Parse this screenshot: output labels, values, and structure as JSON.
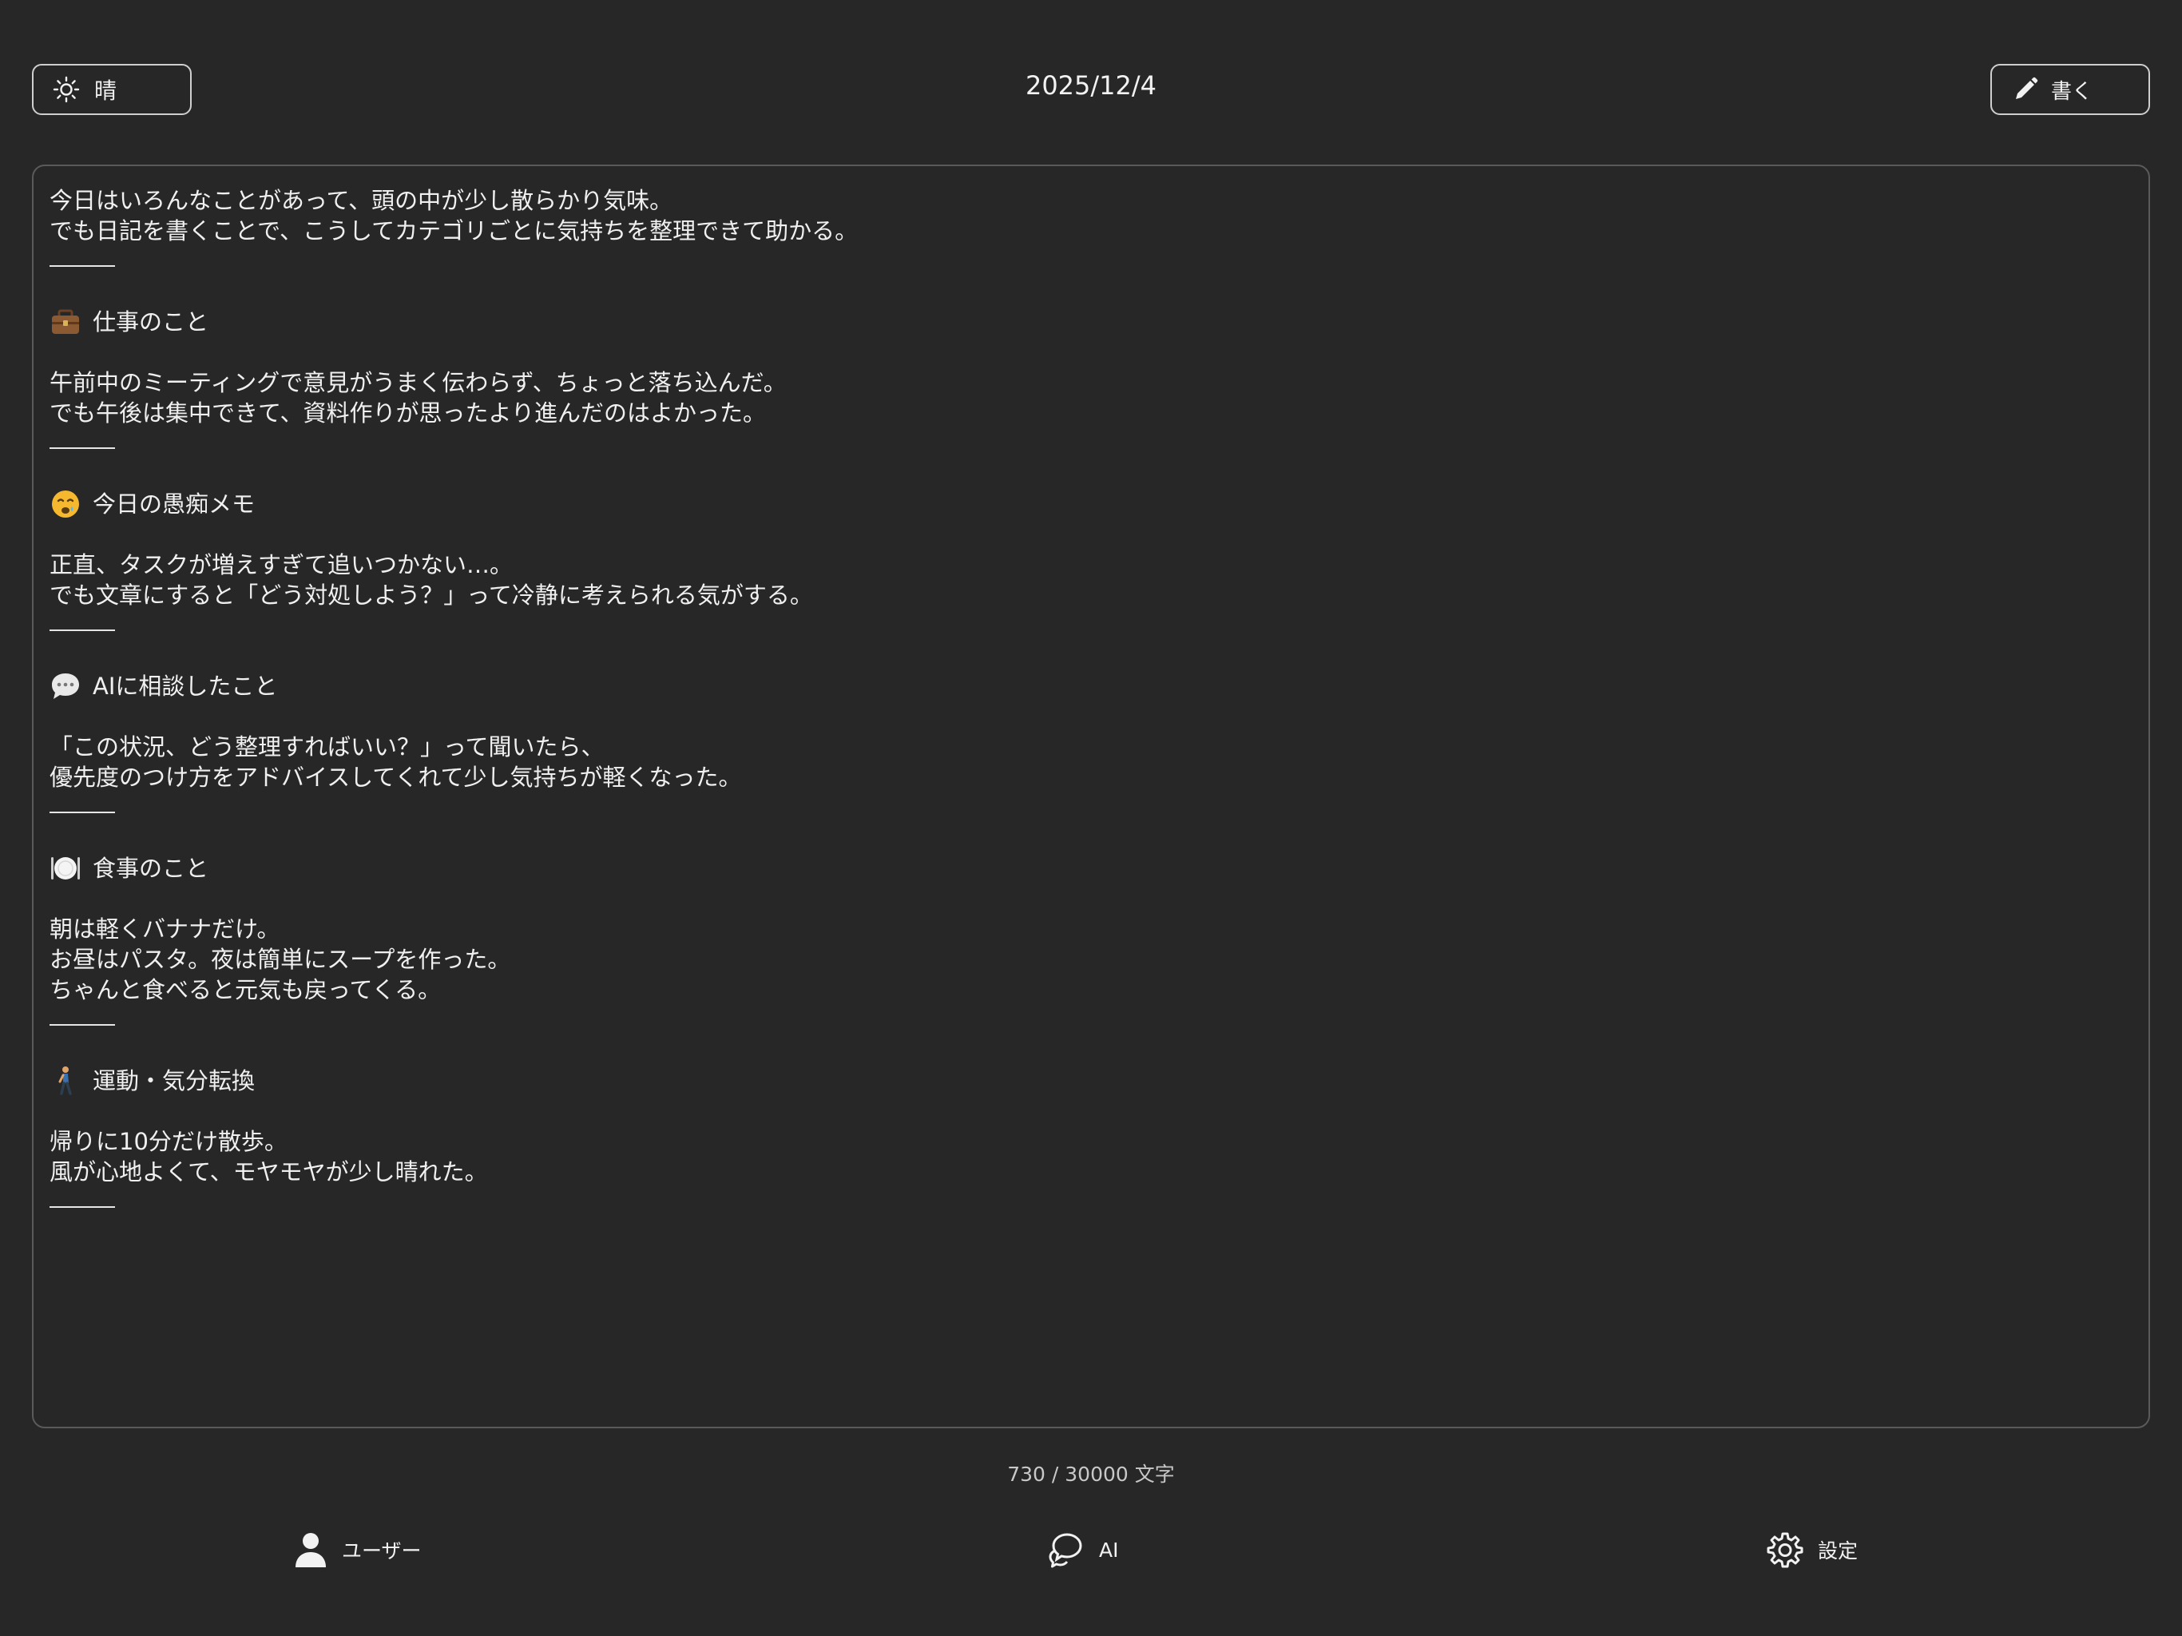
{
  "header": {
    "weather_label": "晴",
    "weather_icon": "sun-icon",
    "date": "2025/12/4",
    "write_label": "書く",
    "write_icon": "pencil-icon"
  },
  "editor": {
    "intro": [
      "今日はいろんなことがあって、頭の中が少し散らかり気味。",
      "でも日記を書くことで、こうしてカテゴリごとに気持ちを整理できて助かる。"
    ],
    "sections": [
      {
        "icon": "briefcase-icon",
        "heading": "仕事のこと",
        "lines": [
          "午前中のミーティングで意見がうまく伝わらず、ちょっと落ち込んだ。",
          "でも午後は集中できて、資料作りが思ったより進んだのはよかった。"
        ]
      },
      {
        "icon": "frustrated-face-icon",
        "heading": "今日の愚痴メモ",
        "lines": [
          "正直、タスクが増えすぎて追いつかない…。",
          "でも文章にすると「どう対処しよう？」って冷静に考えられる気がする。"
        ]
      },
      {
        "icon": "speech-bubble-icon",
        "heading": "AIに相談したこと",
        "lines": [
          "「この状況、どう整理すればいい？」って聞いたら、",
          "優先度のつけ方をアドバイスしてくれて少し気持ちが軽くなった。"
        ]
      },
      {
        "icon": "plate-cutlery-icon",
        "heading": "食事のこと",
        "lines": [
          "朝は軽くバナナだけ。",
          "お昼はパスタ。夜は簡単にスープを作った。",
          "ちゃんと食べると元気も戻ってくる。"
        ]
      },
      {
        "icon": "walking-person-icon",
        "heading": "運動・気分転換",
        "lines": [
          "帰りに10分だけ散歩。",
          "風が心地よくて、モヤモヤが少し晴れた。"
        ]
      }
    ]
  },
  "counter": "730 / 30000 文字",
  "tabbar": {
    "user_label": "ユーザー",
    "ai_label": "AI",
    "settings_label": "設定"
  }
}
